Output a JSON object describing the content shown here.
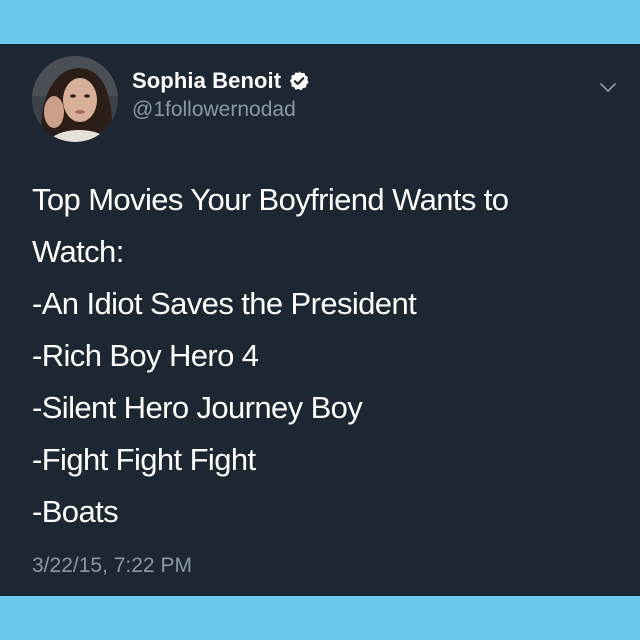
{
  "colors": {
    "frame": "#6cc7e8",
    "card_bg": "#1c2733",
    "text_primary": "#ffffff",
    "text_secondary": "#8899a6",
    "verified": "#ffffff"
  },
  "tweet": {
    "author": {
      "display_name": "Sophia Benoit",
      "handle": "@1followernodad",
      "verified": true,
      "avatar_icon": "profile-photo"
    },
    "menu_icon": "chevron-down-icon",
    "lines": [
      "Top Movies Your Boyfriend Wants to",
      "Watch:",
      "-An Idiot Saves the President",
      "-Rich Boy Hero 4",
      "-Silent Hero Journey Boy",
      "-Fight Fight Fight",
      "-Boats"
    ],
    "timestamp": "3/22/15, 7:22 PM"
  }
}
